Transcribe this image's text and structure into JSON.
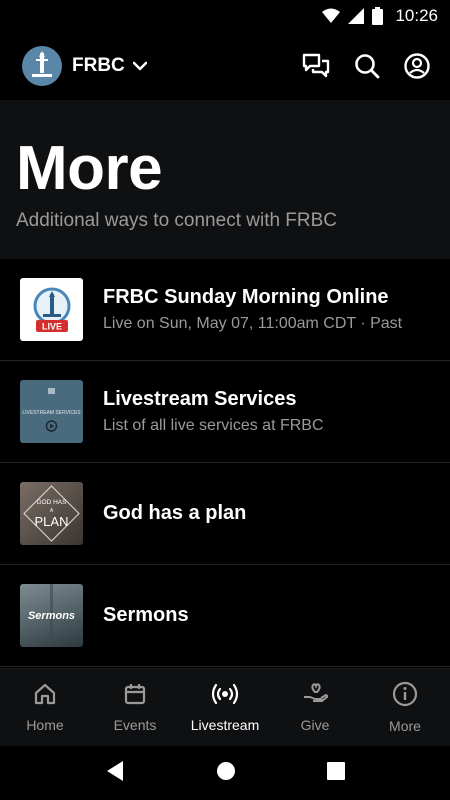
{
  "status_bar": {
    "time": "10:26",
    "icons": [
      "wifi-icon",
      "signal-icon",
      "battery-icon"
    ]
  },
  "header": {
    "org_name": "FRBC",
    "actions": [
      "chat-icon",
      "search-icon",
      "account-icon"
    ]
  },
  "hero": {
    "title": "More",
    "subtitle": "Additional ways to connect with FRBC"
  },
  "items": [
    {
      "title": "FRBC Sunday Morning Online",
      "subtitle": "Live on Sun, May 07, 11:00am CDT · Past",
      "thumb_badge": "LIVE"
    },
    {
      "title": "Livestream Services",
      "subtitle": "List of all live services at FRBC",
      "thumb_text": "LIVESTREAM SERVICES"
    },
    {
      "title": "God has a plan",
      "subtitle": "",
      "thumb_text_top": "GOD HAS",
      "thumb_text_mid": "A",
      "thumb_text_bottom": "PLAN"
    },
    {
      "title": "Sermons",
      "subtitle": "",
      "thumb_text": "Sermons"
    }
  ],
  "tabs": [
    {
      "label": "Home",
      "icon": "home-icon",
      "active": false
    },
    {
      "label": "Events",
      "icon": "calendar-icon",
      "active": false
    },
    {
      "label": "Livestream",
      "icon": "broadcast-icon",
      "active": true
    },
    {
      "label": "Give",
      "icon": "give-icon",
      "active": false
    },
    {
      "label": "More",
      "icon": "info-icon",
      "active": false
    }
  ],
  "colors": {
    "background": "#000000",
    "surface": "#0f1012",
    "text_primary": "#ffffff",
    "text_secondary": "#9a9a9a",
    "live_badge": "#d32f2f",
    "logo_bg": "#5a86a8"
  }
}
